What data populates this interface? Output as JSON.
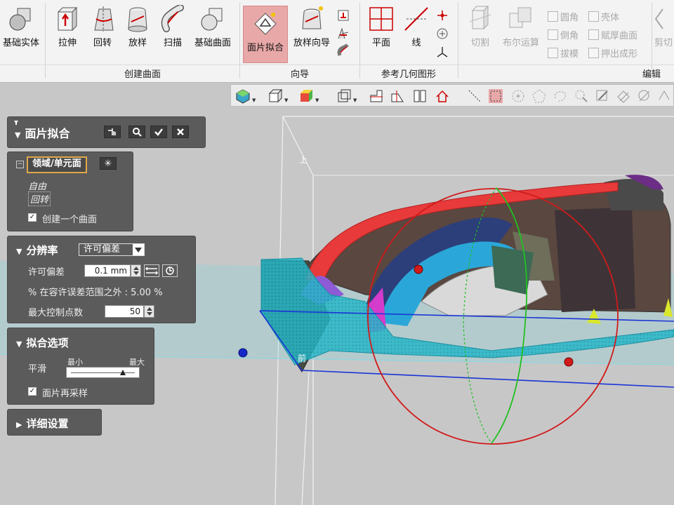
{
  "ribbon": {
    "tools": [
      {
        "label": "基础实体",
        "icon": "basic-solid-icon"
      },
      {
        "label": "拉伸",
        "icon": "extrude-icon"
      },
      {
        "label": "回转",
        "icon": "revolve-icon"
      },
      {
        "label": "放样",
        "icon": "loft-icon"
      },
      {
        "label": "扫描",
        "icon": "sweep-icon"
      },
      {
        "label": "基础曲面",
        "icon": "basic-surface-icon"
      },
      {
        "label": "面片拟合",
        "icon": "mesh-fit-icon"
      },
      {
        "label": "放样向导",
        "icon": "loft-wizard-icon"
      },
      {
        "label": "平面",
        "icon": "plane-icon"
      },
      {
        "label": "线",
        "icon": "line-icon"
      },
      {
        "label": "切割",
        "icon": "cut-icon"
      },
      {
        "label": "布尔运算",
        "icon": "boolean-icon"
      },
      {
        "label": "剪切",
        "icon": "trim-icon"
      }
    ],
    "small_tools": [
      {
        "label": "圆角"
      },
      {
        "label": "壳体"
      },
      {
        "label": "倒角"
      },
      {
        "label": "赋厚曲面"
      },
      {
        "label": "拔模"
      },
      {
        "label": "押出成形"
      }
    ],
    "groups": {
      "create_surface": "创建曲面",
      "wizard": "向导",
      "reference": "参考几何图形",
      "edit": "编辑"
    }
  },
  "viewport": {
    "front_label": "前",
    "top_label": "上"
  },
  "mesh_fit_panel": {
    "title": "面片拟合",
    "select_label": "领域/单元面",
    "free_label": "自由",
    "revolve_label": "回转",
    "create_one_surface": "创建一个曲面",
    "create_one_checked": true
  },
  "resolution_panel": {
    "title": "分辨率",
    "mode_value": "许可偏差",
    "tolerance_label": "许可偏差",
    "tolerance_value": "0.1 mm",
    "outside_text": "% 在容许误差范围之外 : 5.00 %",
    "max_points_label": "最大控制点数",
    "max_points_value": "50"
  },
  "fit_options_panel": {
    "title": "拟合选项",
    "smooth_label": "平滑",
    "min_label": "最小",
    "max_label": "最大",
    "smooth_level": 0.8,
    "resample_label": "面片再采样",
    "resample_checked": true
  },
  "detail_panel": {
    "title": "详细设置"
  },
  "colors": {
    "accent": "#e9a8a8",
    "panel": "#5b5b5b",
    "select_border": "#e0a84a"
  }
}
